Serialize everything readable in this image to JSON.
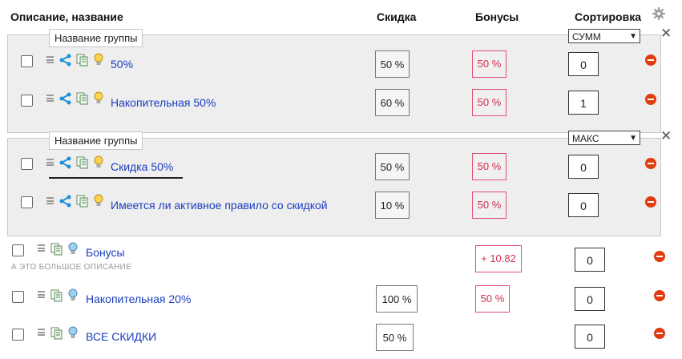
{
  "headers": {
    "description": "Описание, название",
    "discount": "Скидка",
    "bonuses": "Бонусы",
    "sort": "Сортировка"
  },
  "groups": [
    {
      "name": "Название группы",
      "mode": "СУММ",
      "rows": [
        {
          "name": "50%",
          "discount": "50 %",
          "bonus": "50 %",
          "sort": "0"
        },
        {
          "name": "Накопительная 50%",
          "discount": "60 %",
          "bonus": "50 %",
          "sort": "1"
        }
      ]
    },
    {
      "name": "Название группы",
      "mode": "МАКС",
      "rows": [
        {
          "name": "Скидка 50%",
          "discount": "50 %",
          "bonus": "50 %",
          "sort": "0"
        },
        {
          "name": "Имеется ли активное правило со скидкой",
          "discount": "10 %",
          "bonus": "50 %",
          "sort": "0"
        }
      ]
    }
  ],
  "rows": [
    {
      "name": "Бонусы",
      "description": "А ЭТО БОЛЬШОЕ ОПИСАНИЕ",
      "discount": "",
      "bonus": "+ 10.82",
      "sort": "0"
    },
    {
      "name": "Накопительная 20%",
      "discount": "100 %",
      "bonus": "50 %",
      "sort": "0"
    },
    {
      "name": "ВСЕ СКИДКИ",
      "discount": "50 %",
      "bonus": "",
      "sort": "0"
    }
  ],
  "icons": {
    "settings": "gear-icon",
    "drag": "drag-handle-icon",
    "share": "share-icon",
    "copy": "copy-icon",
    "hint": "lightbulb-icon",
    "delete": "delete-icon",
    "close": "close-icon",
    "dropdown": "chevron-down-icon"
  },
  "colors": {
    "link": "#1a3dbf",
    "bonus": "#d03050",
    "delete": "#e03c10",
    "share": "#1e90d8"
  }
}
